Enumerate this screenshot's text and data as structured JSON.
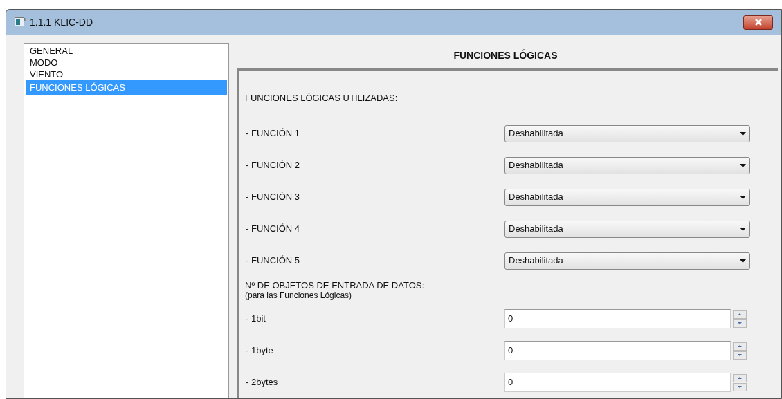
{
  "window": {
    "title": "1.1.1 KLIC-DD"
  },
  "sidebar": {
    "items": [
      {
        "label": "GENERAL",
        "selected": false
      },
      {
        "label": "MODO",
        "selected": false
      },
      {
        "label": "VIENTO",
        "selected": false
      },
      {
        "label": "FUNCIONES LÓGICAS",
        "selected": true
      }
    ]
  },
  "panel": {
    "title": "FUNCIONES LÓGICAS",
    "rows": [
      {
        "kind": "heading",
        "text": "FUNCIONES LÓGICAS UTILIZADAS:"
      },
      {
        "kind": "dropdown",
        "label": "- FUNCIÓN 1",
        "value": "Deshabilitada"
      },
      {
        "kind": "dropdown",
        "label": "- FUNCIÓN 2",
        "value": "Deshabilitada"
      },
      {
        "kind": "dropdown",
        "label": "- FUNCIÓN 3",
        "value": "Deshabilitada"
      },
      {
        "kind": "dropdown",
        "label": "- FUNCIÓN 4",
        "value": "Deshabilitada"
      },
      {
        "kind": "dropdown",
        "label": "- FUNCIÓN 5",
        "value": "Deshabilitada"
      },
      {
        "kind": "heading",
        "text": "Nº DE OBJETOS DE ENTRADA DE DATOS:",
        "note": "(para las Funciones Lógicas)"
      },
      {
        "kind": "spin",
        "label": "- 1bit",
        "value": "0"
      },
      {
        "kind": "spin",
        "label": "- 1byte",
        "value": "0"
      },
      {
        "kind": "spin",
        "label": "- 2bytes",
        "value": "0"
      }
    ]
  }
}
